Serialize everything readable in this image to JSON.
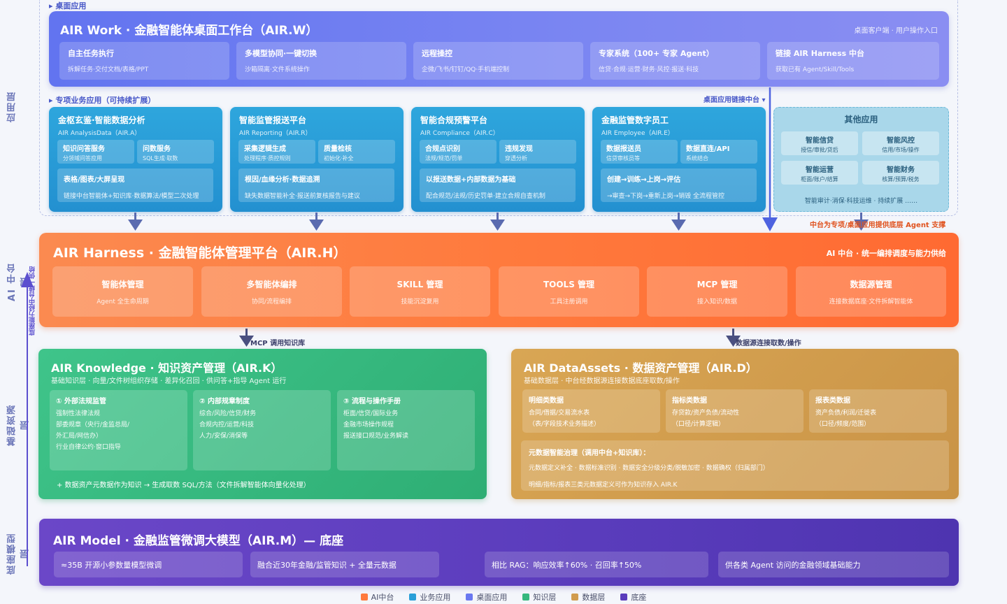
{
  "layers": {
    "app": "应用层",
    "ai": "AI 中台层",
    "base": "基础资源层",
    "model": "底座模型层"
  },
  "side_note": "底座能力经中台统一供给",
  "zone_desktop": "桌面应用",
  "zone_special": "专项业务应用（可持续扩展）",
  "zone_link": "桌面应用链接中台",
  "work": {
    "title": "AIR Work · 金融智能体桌面工作台（AIR.W）",
    "subtitle": "桌面客户端 · 用户操作入口",
    "cards": [
      {
        "title": "自主任务执行",
        "desc": "拆解任务·交付文档/表格/PPT"
      },
      {
        "title": "多模型协同·一键切换",
        "desc": "沙箱隔离·文件系统操作"
      },
      {
        "title": "远程操控",
        "desc": "企微/飞书/钉钉/QQ·手机端控制"
      },
      {
        "title": "专家系统（100+ 专家 Agent）",
        "desc": "信贷·合规·运营·财务·风控·报送·科技"
      },
      {
        "title": "链接 AIR Harness 中台",
        "desc": "获取已有 Agent/Skill/Tools"
      }
    ]
  },
  "biz": [
    {
      "title": "金枢玄鉴·智能数据分析",
      "subtitle": "AIR AnalysisData（AIR.A）",
      "subs": [
        {
          "t": "知识问答服务",
          "d": "分领域问答应用"
        },
        {
          "t": "问数服务",
          "d": "SQL生成·取数"
        }
      ],
      "wide": {
        "t": "表格/图表/大屏呈现",
        "d": "链接中台智能体+知识库·数据算法/模型二次处理"
      }
    },
    {
      "title": "智能监管报送平台",
      "subtitle": "AIR Reporting（AIR.R）",
      "subs": [
        {
          "t": "采集逻辑生成",
          "d": "处理程序·质控规则"
        },
        {
          "t": "质量检核",
          "d": "初始化·补全"
        }
      ],
      "wide": {
        "t": "根因/血缘分析·数据追溯",
        "d": "缺失数据智能补全·报送前复核报告与建议"
      }
    },
    {
      "title": "智能合规预警平台",
      "subtitle": "AIR Compliance（AIR.C）",
      "subs": [
        {
          "t": "合规点识别",
          "d": "法规/规范/罚单"
        },
        {
          "t": "违规发现",
          "d": "穿透分析"
        }
      ],
      "wide": {
        "t": "以报送数据+内部数据为基础",
        "d": "配合规范/法规/历史罚单·建立合规自查机制"
      }
    },
    {
      "title": "金融监管数字员工",
      "subtitle": "AIR Employee（AIR.E）",
      "subs": [
        {
          "t": "数据报送员",
          "d": "信贷审核员等"
        },
        {
          "t": "数据直连/API",
          "d": "系统结合"
        }
      ],
      "wide": {
        "t": "创建→训练→上岗→评估",
        "d": "→审查→下岗→重新上岗→销毁 全流程管控"
      }
    }
  ],
  "other": {
    "title": "其他应用",
    "cards": [
      {
        "t": "智能信贷",
        "d": "授信/审批/贷后"
      },
      {
        "t": "智能风控",
        "d": "信用/市场/操作"
      },
      {
        "t": "智能运营",
        "d": "柜面/账户/结算"
      },
      {
        "t": "智能财务",
        "d": "核算/预算/税务"
      }
    ],
    "footer": "智能审计·消保·科技运维 · 持续扩展 ……"
  },
  "support_note": "中台为专项/桌面应用提供底层 Agent 支撑",
  "harness": {
    "title": "AIR Harness · 金融智能体管理平台（AIR.H）",
    "subtitle": "AI 中台 · 统一编排调度与能力供给",
    "cards": [
      {
        "t": "智能体管理",
        "d": "Agent 全生命周期"
      },
      {
        "t": "多智能体编排",
        "d": "协同/流程编排"
      },
      {
        "t": "SKILL 管理",
        "d": "技能沉淀复用"
      },
      {
        "t": "TOOLS 管理",
        "d": "工具注册调用"
      },
      {
        "t": "MCP 管理",
        "d": "接入知识/数据"
      },
      {
        "t": "数据源管理",
        "d": "连接数据底座·文件拆解智能体"
      }
    ]
  },
  "flow_left": "MCP 调用知识库",
  "flow_right": "数据源连接取数/操作",
  "knowledge": {
    "title": "AIR Knowledge · 知识资产管理（AIR.K）",
    "subtitle": "基础知识层 · 向量/文件树组织存储 · 差异化召回 · 供问答+指导 Agent 运行",
    "cards": [
      {
        "t": "① 外部法规监管",
        "l": "强制性法律法规\n部委规章（央行/金监总局/\n外汇局/网信办）\n行业自律公约·窗口指导"
      },
      {
        "t": "② 内部规章制度",
        "l": "综合/风险/信贷/财务\n合规内控/运营/科技\n人力/安保/消保等"
      },
      {
        "t": "③ 流程与操作手册",
        "l": "柜面/信贷/国际业务\n金融市场操作规程\n报送接口规范/业务解读"
      }
    ],
    "footer": "+ 数据资产元数据作为知识 → 生成取数 SQL/方法（文件拆解智能体向量化处理）"
  },
  "data_assets": {
    "title": "AIR DataAssets · 数据资产管理（AIR.D）",
    "subtitle": "基础数据层 · 中台经数据源连接数据底座取数/操作",
    "cards": [
      {
        "t": "明细类数据",
        "l": "合同/借据/交易流水表\n（表/字段技术业务描述）"
      },
      {
        "t": "指标类数据",
        "l": "存贷款/资产负债/流动性\n（口径/计算逻辑）"
      },
      {
        "t": "报表类数据",
        "l": "资产负债/利润/迁徙表\n（口径/频度/范围）"
      }
    ],
    "gov_title": "元数据智能治理（调用中台+知识库）：",
    "gov_line1": "元数据定义补全 · 数据标准识别 · 数据安全分级分类/脱敏加密 · 数据确权（归属部门）",
    "gov_line2": "明细/指标/报表三类元数据定义可作为知识存入 AIR.K"
  },
  "model": {
    "title": "AIR Model · 金融监管微调大模型（AIR.M）— 底座",
    "cards": [
      "≈35B 开源小参数量模型微调",
      "融合近30年金融/监管知识 + 全量元数据",
      "相比 RAG：响应效率↑60% · 召回率↑50%",
      "供各类 Agent 访问的金融领域基础能力"
    ]
  },
  "legend": [
    {
      "label": "AI中台",
      "color": "#ff7a3d"
    },
    {
      "label": "业务应用",
      "color": "#2a9fd8"
    },
    {
      "label": "桌面应用",
      "color": "#6a78f0"
    },
    {
      "label": "知识层",
      "color": "#36b87e"
    },
    {
      "label": "数据层",
      "color": "#d19c4e"
    },
    {
      "label": "底座",
      "color": "#5a3cbc"
    }
  ]
}
